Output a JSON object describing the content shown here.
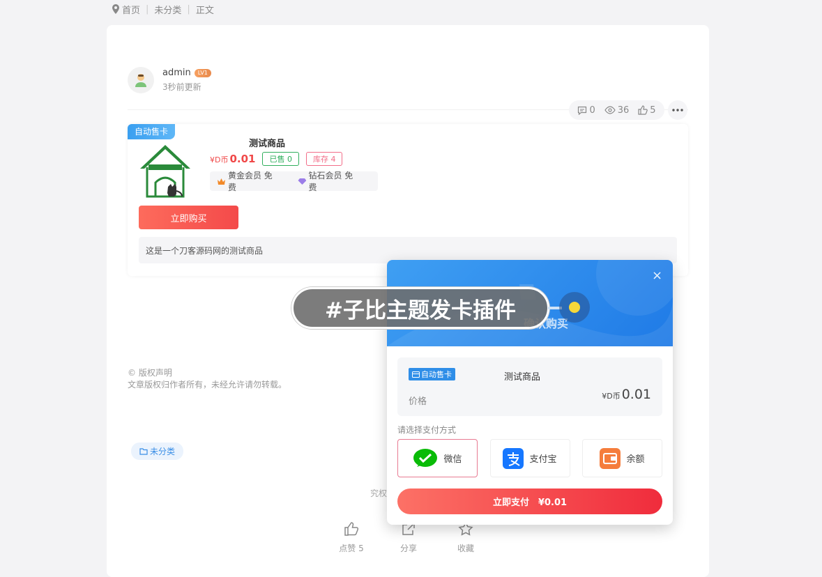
{
  "breadcrumb": {
    "home": "首页",
    "category": "未分类",
    "current": "正文"
  },
  "author": {
    "name": "admin",
    "level": "LV1",
    "time": "3秒前更新"
  },
  "stats": {
    "comments": "0",
    "views": "36",
    "likes": "5"
  },
  "product": {
    "tag": "自动售卡",
    "title": "测试商品",
    "currency": "¥D币",
    "price": "0.01",
    "sold": "已售 0",
    "stock": "库存 4",
    "vip_gold": "黄金会员 免费",
    "vip_diamond": "钻石会员 免费",
    "buy_label": "立即购买",
    "description": "这是一个刀客源码网的测试商品"
  },
  "copyright": {
    "title": "© 版权声明",
    "text": "文章版权归作者所有，未经允许请勿转载。"
  },
  "category_tag": "未分类",
  "hidden_text": "究权",
  "actions": {
    "like": "点赞 5",
    "share": "分享",
    "favorite": "收藏"
  },
  "modal": {
    "title": "确认购买",
    "close": "×",
    "tag": "自动售卡",
    "product_name": "测试商品",
    "price_label": "价格",
    "currency": "¥D币",
    "price": "0.01",
    "pay_label": "请选择支付方式",
    "methods": {
      "wechat": "微信",
      "alipay": "支付宝",
      "balance": "余额"
    },
    "pay_button": "立即支付　¥0.01"
  },
  "overlay": {
    "text": "#子比主题发卡插件"
  },
  "colors": {
    "accent": "#f44a4a",
    "primary": "#3a9ff0",
    "wechat": "#09bb07",
    "alipay": "#1677ff"
  }
}
